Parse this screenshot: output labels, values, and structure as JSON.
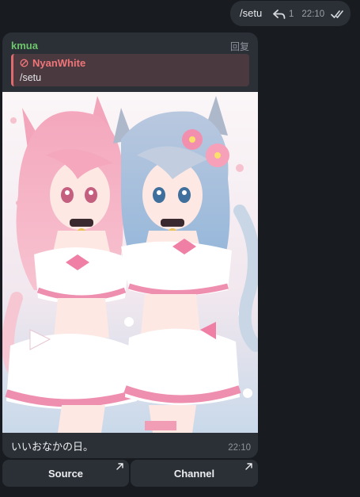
{
  "outgoing": {
    "text": "/setu",
    "reply_count": "1",
    "time": "22:10",
    "icons": {
      "reply": "reply-arrow-icon",
      "status": "double-check-icon"
    }
  },
  "incoming": {
    "sender": "kmua",
    "reply_action": "回复",
    "quote": {
      "name": "NyanWhite",
      "text": "/setu",
      "icon": "blocked-circle-icon"
    },
    "image": {
      "subject": "illustration-two-catgirls"
    },
    "caption": "いいおなかの日。",
    "time": "22:10"
  },
  "buttons": [
    {
      "label": "Source",
      "icon": "external-arrow-icon"
    },
    {
      "label": "Channel",
      "icon": "external-arrow-icon"
    }
  ],
  "colors": {
    "background": "#181b1f",
    "bubble": "#2b3037",
    "sender": "#6cc56a",
    "quote_accent": "#e06a6e",
    "quote_bg": "#4a3a3f"
  }
}
